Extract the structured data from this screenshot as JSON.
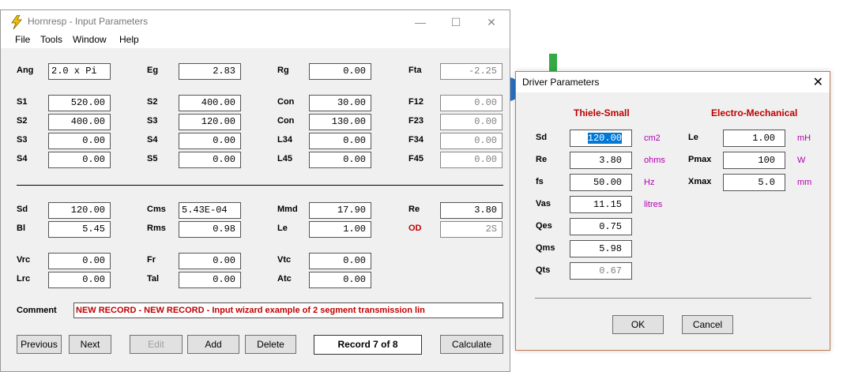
{
  "main_window": {
    "title": "Hornresp - Input Parameters",
    "controls": {
      "minimize": "—",
      "maximize": "☐",
      "close": "✕"
    },
    "menu": [
      "File",
      "Tools",
      "Window",
      "Help"
    ],
    "params": {
      "ang": {
        "label": "Ang",
        "value": "2.0 x Pi"
      },
      "eg": {
        "label": "Eg",
        "value": "2.83"
      },
      "rg": {
        "label": "Rg",
        "value": "0.00"
      },
      "fta": {
        "label": "Fta",
        "value": "-2.25"
      },
      "s1": {
        "label": "S1",
        "value": "520.00"
      },
      "s2a": {
        "label": "S2",
        "value": "400.00"
      },
      "s3a": {
        "label": "S3",
        "value": "0.00"
      },
      "s4a": {
        "label": "S4",
        "value": "0.00"
      },
      "s2b": {
        "label": "S2",
        "value": "400.00"
      },
      "s3b": {
        "label": "S3",
        "value": "120.00"
      },
      "s4b": {
        "label": "S4",
        "value": "0.00"
      },
      "s5": {
        "label": "S5",
        "value": "0.00"
      },
      "con1": {
        "label": "Con",
        "value": "30.00"
      },
      "con2": {
        "label": "Con",
        "value": "130.00"
      },
      "l34": {
        "label": "L34",
        "value": "0.00"
      },
      "l45": {
        "label": "L45",
        "value": "0.00"
      },
      "f12": {
        "label": "F12",
        "value": "0.00"
      },
      "f23": {
        "label": "F23",
        "value": "0.00"
      },
      "f34": {
        "label": "F34",
        "value": "0.00"
      },
      "f45": {
        "label": "F45",
        "value": "0.00"
      },
      "sd": {
        "label": "Sd",
        "value": "120.00"
      },
      "bl": {
        "label": "Bl",
        "value": "5.45"
      },
      "cms": {
        "label": "Cms",
        "value": "5.43E-04"
      },
      "rms": {
        "label": "Rms",
        "value": "0.98"
      },
      "mmd": {
        "label": "Mmd",
        "value": "17.90"
      },
      "le": {
        "label": "Le",
        "value": "1.00"
      },
      "re": {
        "label": "Re",
        "value": "3.80"
      },
      "od": {
        "label": "OD",
        "value": "2S"
      },
      "vrc": {
        "label": "Vrc",
        "value": "0.00"
      },
      "lrc": {
        "label": "Lrc",
        "value": "0.00"
      },
      "fr": {
        "label": "Fr",
        "value": "0.00"
      },
      "tal": {
        "label": "Tal",
        "value": "0.00"
      },
      "vtc": {
        "label": "Vtc",
        "value": "0.00"
      },
      "atc": {
        "label": "Atc",
        "value": "0.00"
      }
    },
    "comment": {
      "label": "Comment",
      "value": "NEW RECORD - NEW RECORD - Input wizard example of 2 segment transmission lin"
    },
    "buttons": {
      "previous": "Previous",
      "next": "Next",
      "edit": "Edit",
      "add": "Add",
      "delete": "Delete",
      "calculate": "Calculate"
    },
    "record": "Record 7 of 8"
  },
  "driver_dialog": {
    "title": "Driver Parameters",
    "close": "✕",
    "thiele_small": {
      "heading": "Thiele-Small",
      "rows": [
        {
          "label": "Sd",
          "value": "120.00",
          "unit": "cm2"
        },
        {
          "label": "Re",
          "value": "3.80",
          "unit": "ohms"
        },
        {
          "label": "fs",
          "value": "50.00",
          "unit": "Hz"
        },
        {
          "label": "Vas",
          "value": "11.15",
          "unit": "litres"
        },
        {
          "label": "Qes",
          "value": "0.75",
          "unit": ""
        },
        {
          "label": "Qms",
          "value": "5.98",
          "unit": ""
        },
        {
          "label": "Qts",
          "value": "0.67",
          "unit": ""
        }
      ]
    },
    "electro_mechanical": {
      "heading": "Electro-Mechanical",
      "rows": [
        {
          "label": "Le",
          "value": "1.00",
          "unit": "mH"
        },
        {
          "label": "Pmax",
          "value": "100",
          "unit": "W"
        },
        {
          "label": "Xmax",
          "value": "5.0",
          "unit": "mm"
        }
      ]
    },
    "buttons": {
      "ok": "OK",
      "cancel": "Cancel"
    }
  },
  "colors": {
    "label_red": "#c00000",
    "units_magenta": "#b000b0",
    "selection_blue": "#0078d7"
  }
}
